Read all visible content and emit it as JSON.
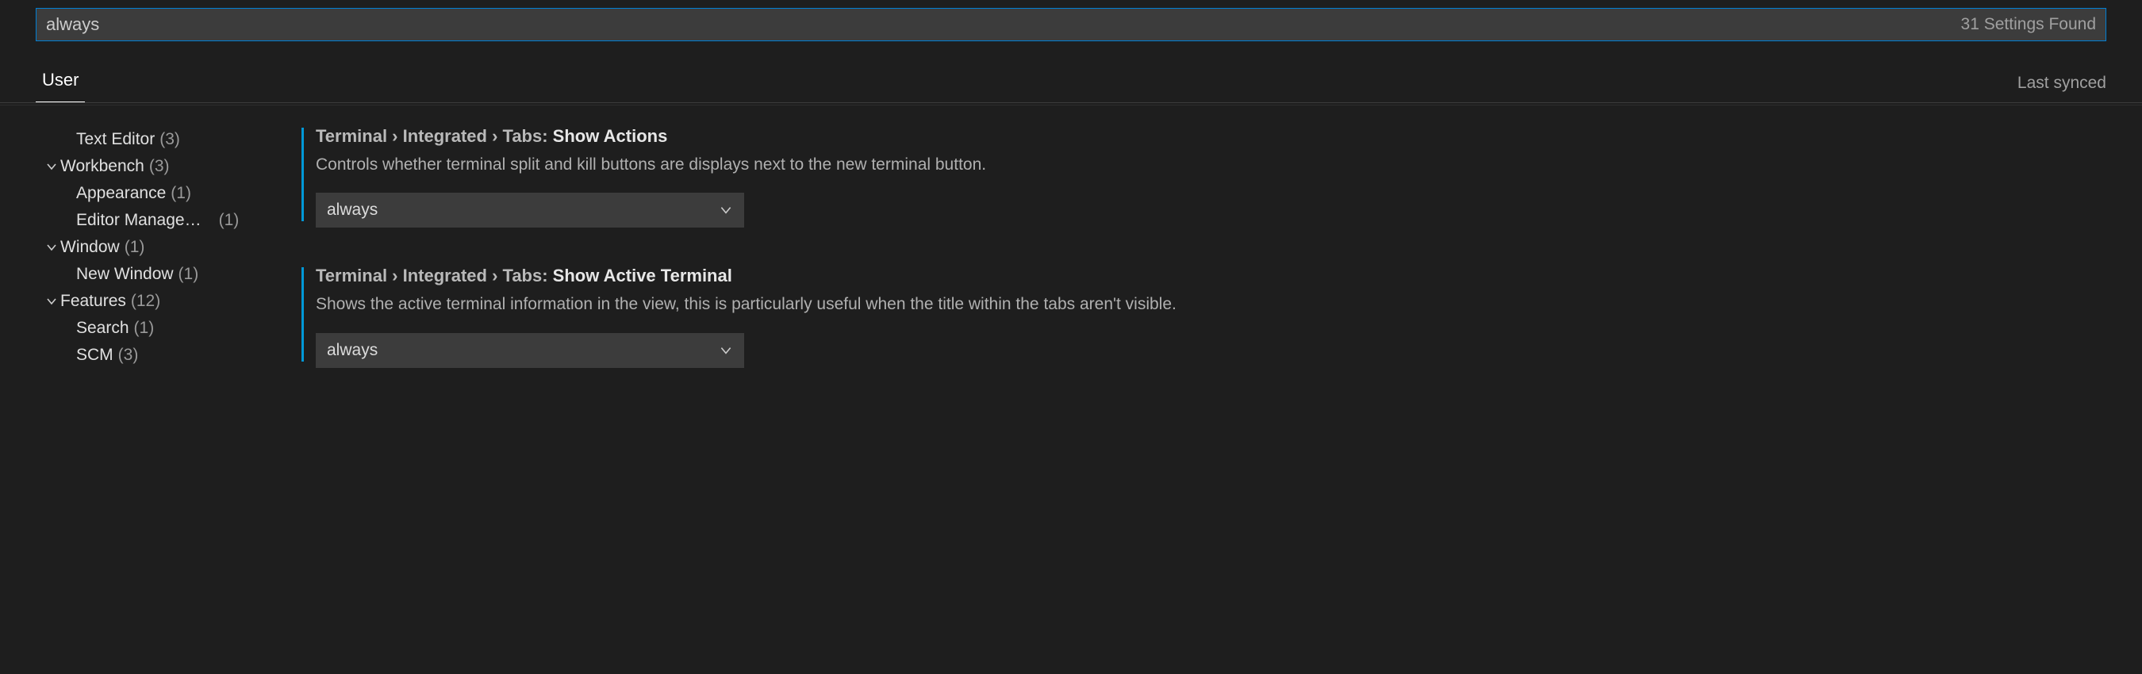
{
  "search": {
    "value": "always",
    "result_count": "31 Settings Found"
  },
  "tabs": {
    "user": "User",
    "sync_status": "Last synced"
  },
  "sidebar": {
    "text_editor": {
      "label": "Text Editor",
      "count": "(3)"
    },
    "workbench": {
      "label": "Workbench",
      "count": "(3)"
    },
    "appearance": {
      "label": "Appearance",
      "count": "(1)"
    },
    "editor_mgmt": {
      "label": "Editor Manage…",
      "count": "(1)"
    },
    "window": {
      "label": "Window",
      "count": "(1)"
    },
    "new_window": {
      "label": "New Window",
      "count": "(1)"
    },
    "features": {
      "label": "Features",
      "count": "(12)"
    },
    "search_cat": {
      "label": "Search",
      "count": "(1)"
    },
    "scm": {
      "label": "SCM",
      "count": "(3)"
    }
  },
  "settings": [
    {
      "path": "Terminal › Integrated › Tabs: ",
      "leaf": "Show Actions",
      "desc": "Controls whether terminal split and kill buttons are displays next to the new terminal button.",
      "value": "always"
    },
    {
      "path": "Terminal › Integrated › Tabs: ",
      "leaf": "Show Active Terminal",
      "desc": "Shows the active terminal information in the view, this is particularly useful when the title within the tabs aren't visible.",
      "value": "always"
    }
  ]
}
